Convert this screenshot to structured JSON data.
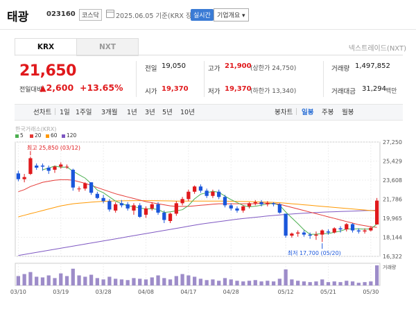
{
  "header": {
    "name": "태광",
    "code": "023160",
    "market": "코스닥",
    "date_text": "2025.06.05  기준(KRX 장마감)",
    "realtime_label": "실시간",
    "company_info_label": "기업개요"
  },
  "tabs": {
    "krx": "KRX",
    "nxt": "NXT",
    "nextrade_link": "넥스트레이드(NXT)"
  },
  "quote": {
    "price": "21,650",
    "change_label": "전일대비",
    "change": "▲2,600",
    "change_pct": "+13.65%",
    "prev_close_label": "전일",
    "prev_close": "19,050",
    "open_label": "시가",
    "open": "19,370",
    "high_label": "고가",
    "high": "21,900",
    "upper_limit": "(상한가 24,750)",
    "low_label": "저가",
    "low": "19,370",
    "lower_limit": "(하한가 13,340)",
    "volume_label": "거래량",
    "volume": "1,497,852",
    "value_label": "거래대금",
    "value": "31,294",
    "value_unit": "백만"
  },
  "toolbar": {
    "line_chart": "선차트",
    "d1": "1일",
    "w1": "1주일",
    "m3": "3개월",
    "y1": "1년",
    "y3": "3년",
    "y5": "5년",
    "y10": "10년",
    "candle": "봉차트",
    "daily": "일봉",
    "weekly": "주봉",
    "monthly": "월봉"
  },
  "chart_source": "한국거래소(KRX)",
  "colors": {
    "up": "#e0191c",
    "down": "#1a56db",
    "ma5": "#4caf50",
    "ma20": "#e53935",
    "ma60": "#ff9800",
    "ma120": "#7e57c2",
    "volume": "#9d8cc9"
  },
  "chart_data": {
    "type": "candlestick",
    "ma_legend": [
      "5",
      "20",
      "60",
      "120"
    ],
    "y_ticks": [
      "27,250",
      "25,429",
      "23,608",
      "21,786",
      "19,965",
      "18,144",
      "16,322"
    ],
    "ylim": [
      16322,
      27250
    ],
    "x_ticks": [
      {
        "label": "03/10",
        "index": 0
      },
      {
        "label": "03/19",
        "index": 7
      },
      {
        "label": "03/28",
        "index": 14
      },
      {
        "label": "04/08",
        "index": 21
      },
      {
        "label": "04/17",
        "index": 28
      },
      {
        "label": "04/28",
        "index": 35
      },
      {
        "label": "05/12",
        "index": 44
      },
      {
        "label": "05/21",
        "index": 51
      },
      {
        "label": "05/30",
        "index": 58
      }
    ],
    "high_annotation": "최고 25,850 (03/12)",
    "low_annotation": "최저 17,700 (05/20)",
    "volume_label": "거래량",
    "candles": [
      [
        24250,
        23700,
        24500,
        23500
      ],
      [
        23700,
        23900,
        24200,
        23400
      ],
      [
        24200,
        25700,
        25850,
        24100
      ],
      [
        25000,
        24800,
        25200,
        24600
      ],
      [
        25000,
        24900,
        25200,
        24500
      ],
      [
        24800,
        24500,
        25000,
        24200
      ],
      [
        24600,
        24900,
        25000,
        24300
      ],
      [
        24900,
        25100,
        25300,
        24700
      ],
      [
        24900,
        24900,
        25100,
        24700
      ],
      [
        24600,
        22900,
        24700,
        22600
      ],
      [
        22800,
        22800,
        23000,
        22500
      ],
      [
        22800,
        23300,
        23400,
        22600
      ],
      [
        23400,
        22400,
        23400,
        22200
      ],
      [
        22300,
        21900,
        22500,
        21800
      ],
      [
        21900,
        21600,
        22200,
        21400
      ],
      [
        21600,
        20800,
        21800,
        20600
      ],
      [
        20700,
        21300,
        21500,
        20500
      ],
      [
        21400,
        21200,
        21700,
        21000
      ],
      [
        21300,
        20900,
        21500,
        20700
      ],
      [
        20700,
        21200,
        21400,
        20300
      ],
      [
        21200,
        20100,
        21400,
        20000
      ],
      [
        20300,
        20900,
        21100,
        20000
      ],
      [
        20900,
        21300,
        21500,
        20700
      ],
      [
        21300,
        20500,
        21500,
        20300
      ],
      [
        20500,
        19800,
        20700,
        19500
      ],
      [
        19700,
        20400,
        20500,
        19500
      ],
      [
        20400,
        21400,
        21600,
        20200
      ],
      [
        21400,
        21800,
        22000,
        21200
      ],
      [
        21800,
        22500,
        22700,
        21600
      ],
      [
        22500,
        23000,
        23100,
        22300
      ],
      [
        23000,
        22600,
        23200,
        22400
      ],
      [
        22600,
        22100,
        22800,
        21900
      ],
      [
        22100,
        22500,
        22700,
        21900
      ],
      [
        22500,
        22000,
        22700,
        21800
      ],
      [
        22000,
        21200,
        22200,
        21000
      ],
      [
        21200,
        20900,
        21400,
        20700
      ],
      [
        20900,
        20700,
        21100,
        20500
      ],
      [
        20700,
        21100,
        21200,
        20500
      ],
      [
        21100,
        21400,
        21500,
        20900
      ],
      [
        21400,
        21500,
        21700,
        21200
      ],
      [
        21500,
        21300,
        21700,
        21100
      ],
      [
        21300,
        21400,
        21600,
        21100
      ],
      [
        21400,
        21300,
        21500,
        21100
      ],
      [
        21300,
        20500,
        21400,
        20400
      ],
      [
        20400,
        18300,
        20400,
        18100
      ],
      [
        18300,
        18500,
        18600,
        18100
      ],
      [
        18500,
        18600,
        18800,
        18200
      ],
      [
        18600,
        18400,
        18800,
        18200
      ],
      [
        18400,
        18300,
        18600,
        18000
      ],
      [
        18300,
        18400,
        18700,
        17900
      ],
      [
        18400,
        18800,
        18900,
        17700
      ],
      [
        18700,
        18600,
        18900,
        18400
      ],
      [
        18600,
        19000,
        19100,
        18500
      ],
      [
        19000,
        18900,
        19200,
        18600
      ],
      [
        18900,
        19400,
        19500,
        18700
      ],
      [
        19400,
        18800,
        19500,
        18600
      ],
      [
        18800,
        18700,
        19000,
        18500
      ],
      [
        18700,
        18800,
        19000,
        18500
      ],
      [
        18800,
        19050,
        19200,
        18700
      ],
      [
        19370,
        21650,
        21900,
        19370
      ]
    ],
    "volume": [
      28,
      34,
      40,
      26,
      24,
      30,
      22,
      36,
      28,
      50,
      30,
      26,
      32,
      22,
      18,
      26,
      20,
      18,
      16,
      22,
      20,
      18,
      24,
      30,
      22,
      18,
      28,
      34,
      30,
      26,
      20,
      16,
      18,
      14,
      22,
      18,
      14,
      12,
      14,
      16,
      12,
      14,
      12,
      20,
      48,
      18,
      14,
      12,
      10,
      12,
      18,
      10,
      12,
      10,
      14,
      12,
      8,
      10,
      12,
      60
    ],
    "ma5_start": 4,
    "ma20_start": 0,
    "ma60_start": 0,
    "ma120_start": 0,
    "ma20": [
      22500,
      22700,
      23000,
      23200,
      23400,
      23500,
      23600,
      23650,
      23650,
      23600,
      23450,
      23300,
      23100,
      22900,
      22700,
      22500,
      22300,
      22150,
      22000,
      21850,
      21700,
      21550,
      21450,
      21350,
      21250,
      21150,
      21100,
      21100,
      21100,
      21150,
      21200,
      21250,
      21300,
      21350,
      21350,
      21350,
      21350,
      21350,
      21350,
      21350,
      21400,
      21400,
      21380,
      21300,
      21150,
      21000,
      20850,
      20700,
      20550,
      20400,
      20250,
      20100,
      19950,
      19800,
      19650,
      19500,
      19350,
      19250,
      19150,
      19100
    ],
    "ma60": [
      20100,
      20250,
      20400,
      20550,
      20700,
      20850,
      21000,
      21150,
      21250,
      21350,
      21400,
      21450,
      21500,
      21550,
      21580,
      21600,
      21620,
      21630,
      21640,
      21650,
      21650,
      21650,
      21650,
      21640,
      21630,
      21620,
      21610,
      21600,
      21600,
      21600,
      21600,
      21600,
      21600,
      21600,
      21600,
      21590,
      21580,
      21570,
      21560,
      21540,
      21520,
      21500,
      21480,
      21450,
      21400,
      21350,
      21300,
      21250,
      21200,
      21150,
      21100,
      21050,
      21000,
      20950,
      20900,
      20850,
      20800,
      20750,
      20700,
      20680
    ],
    "ma120": [
      16400,
      16500,
      16600,
      16700,
      16800,
      16900,
      17000,
      17100,
      17200,
      17300,
      17400,
      17500,
      17600,
      17700,
      17800,
      17900,
      18000,
      18100,
      18200,
      18300,
      18400,
      18500,
      18600,
      18700,
      18800,
      18900,
      19000,
      19100,
      19200,
      19300,
      19400,
      19480,
      19560,
      19640,
      19720,
      19800,
      19870,
      19940,
      20000,
      20060,
      20120,
      20180,
      20230,
      20280,
      20330,
      20370,
      20410,
      20450,
      20480,
      20510,
      20540,
      20570,
      20590,
      20610,
      20630,
      20650,
      20670,
      20690,
      20710,
      20730
    ]
  }
}
